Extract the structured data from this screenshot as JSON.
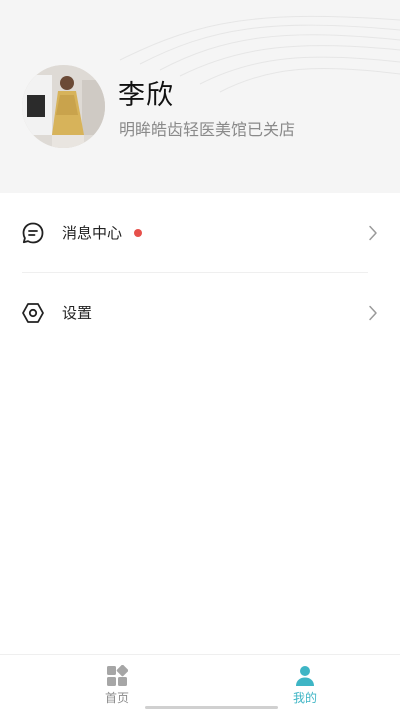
{
  "profile": {
    "name": "李欣",
    "subtitle": "明眸皓齿轻医美馆已关店"
  },
  "menu": {
    "items": [
      {
        "label": "消息中心",
        "icon": "message-icon",
        "has_unread_dot": true
      },
      {
        "label": "设置",
        "icon": "settings-hexagon-icon",
        "has_unread_dot": false
      }
    ]
  },
  "tabbar": {
    "tabs": [
      {
        "label": "首页",
        "icon": "grid-home-icon",
        "active": false
      },
      {
        "label": "我的",
        "icon": "person-icon",
        "active": true
      }
    ]
  },
  "colors": {
    "header_bg": "#f5f5f5",
    "accent": "#3eb5c5",
    "unread_dot": "#e6504b",
    "inactive_tab": "#8c8c8c"
  }
}
